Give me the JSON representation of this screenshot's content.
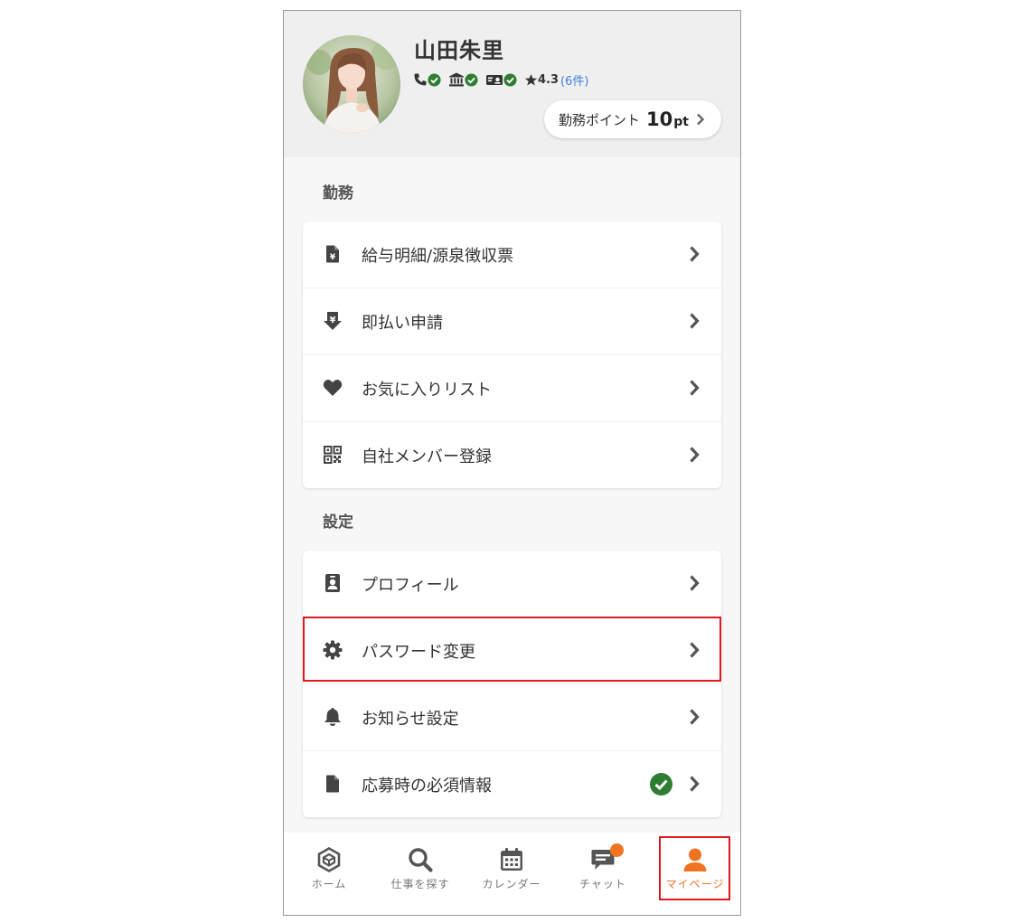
{
  "profile": {
    "name": "山田朱里",
    "rating": "4.3",
    "review_count": "(6件)",
    "points_label": "勤務ポイント",
    "points_value": "10",
    "points_unit": "pt",
    "verified": [
      "phone-icon",
      "bank-icon",
      "id-card-icon"
    ]
  },
  "sections": {
    "work": {
      "title": "勤務",
      "items": [
        {
          "label": "給与明細/源泉徴収票",
          "icon": "yen-document-icon"
        },
        {
          "label": "即払い申請",
          "icon": "yen-download-icon"
        },
        {
          "label": "お気に入りリスト",
          "icon": "heart-icon"
        },
        {
          "label": "自社メンバー登録",
          "icon": "qr-code-icon"
        }
      ]
    },
    "settings": {
      "title": "設定",
      "items": [
        {
          "label": "プロフィール",
          "icon": "id-badge-icon"
        },
        {
          "label": "パスワード変更",
          "icon": "gear-icon"
        },
        {
          "label": "お知らせ設定",
          "icon": "bell-icon"
        },
        {
          "label": "応募時の必須情報",
          "icon": "file-icon",
          "completed": true
        }
      ]
    }
  },
  "tabbar": {
    "tabs": [
      {
        "label": "ホーム",
        "icon": "home-hexagon-icon"
      },
      {
        "label": "仕事を探す",
        "icon": "search-icon"
      },
      {
        "label": "カレンダー",
        "icon": "calendar-icon"
      },
      {
        "label": "チャット",
        "icon": "chat-icon",
        "has_notification": true
      },
      {
        "label": "マイページ",
        "icon": "user-icon",
        "active": true
      }
    ]
  },
  "colors": {
    "accent": "#ef7320",
    "verified_green": "#2e7d32",
    "link_blue": "#3f7de0",
    "highlight_red": "#e0181e"
  }
}
